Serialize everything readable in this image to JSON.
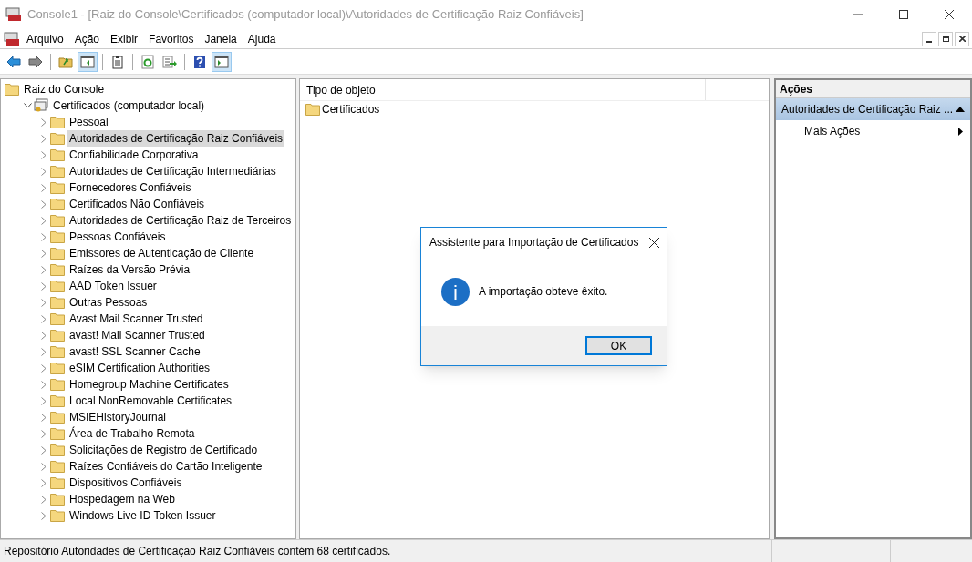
{
  "window": {
    "title": "Console1 - [Raiz do Console\\Certificados (computador local)\\Autoridades de Certificação Raiz Confiáveis]"
  },
  "menu": [
    "Arquivo",
    "Ação",
    "Exibir",
    "Favoritos",
    "Janela",
    "Ajuda"
  ],
  "toolbar": [
    {
      "kind": "back",
      "pressed": false
    },
    {
      "kind": "forward",
      "pressed": false
    },
    {
      "kind": "sep"
    },
    {
      "kind": "up",
      "pressed": false
    },
    {
      "kind": "tree",
      "pressed": true
    },
    {
      "kind": "sep"
    },
    {
      "kind": "clipboard",
      "pressed": false
    },
    {
      "kind": "sep"
    },
    {
      "kind": "refresh",
      "pressed": false
    },
    {
      "kind": "export",
      "pressed": false
    },
    {
      "kind": "sep"
    },
    {
      "kind": "help",
      "pressed": false
    },
    {
      "kind": "pane",
      "pressed": true
    }
  ],
  "tree": [
    {
      "label": "Raiz do Console",
      "kind": "folder",
      "selected": false,
      "children": [
        {
          "label": "Certificados (computador local)",
          "kind": "store",
          "expanded": true,
          "selected": false,
          "children": [
            {
              "label": "Pessoal",
              "kind": "folder",
              "expanded": false,
              "selected": false
            },
            {
              "label": "Autoridades de Certificação Raiz Confiáveis",
              "kind": "folder",
              "expanded": false,
              "selected": true
            },
            {
              "label": "Confiabilidade Corporativa",
              "kind": "folder",
              "expanded": false,
              "selected": false
            },
            {
              "label": "Autoridades de Certificação Intermediárias",
              "kind": "folder",
              "expanded": false,
              "selected": false
            },
            {
              "label": "Fornecedores Confiáveis",
              "kind": "folder",
              "expanded": false,
              "selected": false
            },
            {
              "label": "Certificados Não Confiáveis",
              "kind": "folder",
              "expanded": false,
              "selected": false
            },
            {
              "label": "Autoridades de Certificação Raiz de Terceiros",
              "kind": "folder",
              "expanded": false,
              "selected": false
            },
            {
              "label": "Pessoas Confiáveis",
              "kind": "folder",
              "expanded": false,
              "selected": false
            },
            {
              "label": "Emissores de Autenticação de Cliente",
              "kind": "folder",
              "expanded": false,
              "selected": false
            },
            {
              "label": "Raízes da Versão Prévia",
              "kind": "folder",
              "expanded": false,
              "selected": false
            },
            {
              "label": "AAD Token Issuer",
              "kind": "folder",
              "expanded": false,
              "selected": false
            },
            {
              "label": "Outras Pessoas",
              "kind": "folder",
              "expanded": false,
              "selected": false
            },
            {
              "label": "Avast Mail Scanner Trusted",
              "kind": "folder",
              "expanded": false,
              "selected": false
            },
            {
              "label": "avast! Mail Scanner Trusted",
              "kind": "folder",
              "expanded": false,
              "selected": false
            },
            {
              "label": "avast! SSL Scanner Cache",
              "kind": "folder",
              "expanded": false,
              "selected": false
            },
            {
              "label": "eSIM Certification Authorities",
              "kind": "folder",
              "expanded": false,
              "selected": false
            },
            {
              "label": "Homegroup Machine Certificates",
              "kind": "folder",
              "expanded": false,
              "selected": false
            },
            {
              "label": "Local NonRemovable Certificates",
              "kind": "folder",
              "expanded": false,
              "selected": false
            },
            {
              "label": "MSIEHistoryJournal",
              "kind": "folder",
              "expanded": false,
              "selected": false
            },
            {
              "label": "Área de Trabalho Remota",
              "kind": "folder",
              "expanded": false,
              "selected": false
            },
            {
              "label": "Solicitações de Registro de Certificado",
              "kind": "folder",
              "expanded": false,
              "selected": false
            },
            {
              "label": "Raízes Confiáveis do Cartão Inteligente",
              "kind": "folder",
              "expanded": false,
              "selected": false
            },
            {
              "label": "Dispositivos Confiáveis",
              "kind": "folder",
              "expanded": false,
              "selected": false
            },
            {
              "label": "Hospedagem na Web",
              "kind": "folder",
              "expanded": false,
              "selected": false
            },
            {
              "label": "Windows Live ID Token Issuer",
              "kind": "folder",
              "expanded": false,
              "selected": false
            }
          ]
        }
      ]
    }
  ],
  "list": {
    "columns": [
      "Tipo de objeto"
    ],
    "rows": [
      "Certificados"
    ]
  },
  "actions": {
    "header": "Ações",
    "section": "Autoridades de Certificação Raiz ...",
    "items": [
      "Mais Ações"
    ]
  },
  "dialog": {
    "title": "Assistente para Importação de Certificados",
    "message": "A importação obteve êxito.",
    "button": "OK"
  },
  "status_bar": "Repositório Autoridades de Certificação Raiz Confiáveis contém 68 certificados."
}
